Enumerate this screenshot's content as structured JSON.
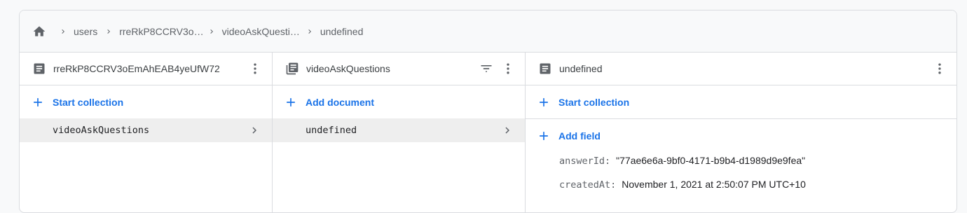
{
  "breadcrumb": {
    "items": [
      "users",
      "rreRkP8CCRV3o…",
      "videoAskQuesti…",
      "undefined"
    ]
  },
  "columns": [
    {
      "title": "rreRkP8CCRV3oEmAhEAB4yeUfW72",
      "action": "Start collection",
      "items": [
        "videoAskQuestions"
      ]
    },
    {
      "title": "videoAskQuestions",
      "action": "Add document",
      "items": [
        "undefined"
      ]
    },
    {
      "title": "undefined",
      "action": "Start collection",
      "action2": "Add field",
      "fields": [
        {
          "key": "answerId:",
          "value": "\"77ae6e6a-9bf0-4171-b9b4-d1989d9e9fea\""
        },
        {
          "key": "createdAt:",
          "value": "November 1, 2021 at 2:50:07 PM UTC+10"
        }
      ]
    }
  ],
  "colors": {
    "accent": "#1a73e8",
    "selected_row": "#eeeeee",
    "border": "#dadce0"
  }
}
